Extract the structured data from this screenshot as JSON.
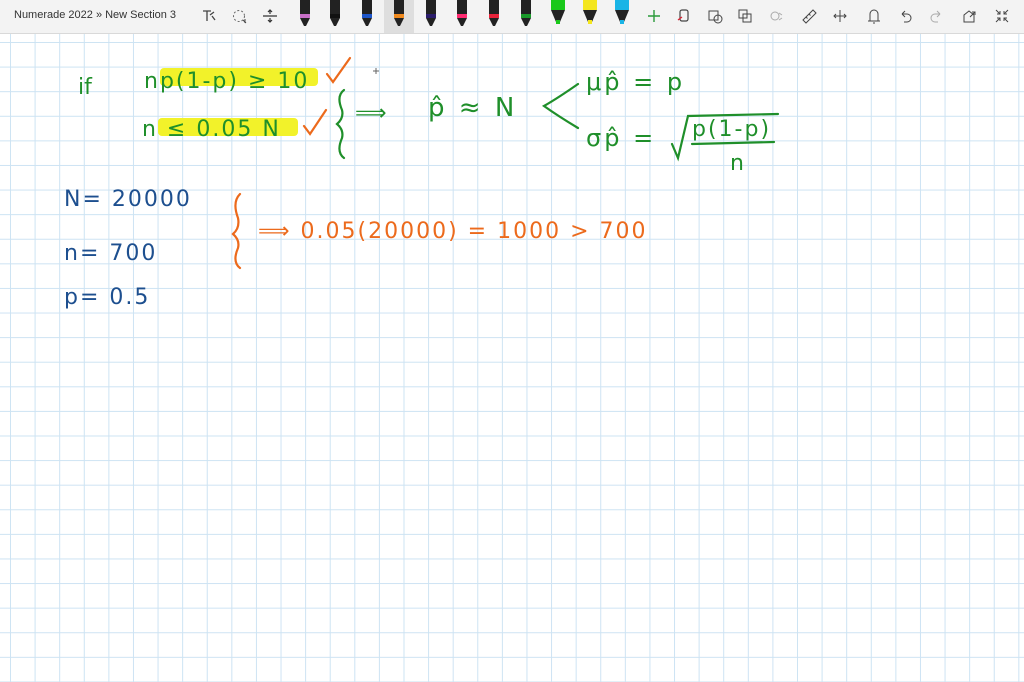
{
  "toolbar": {
    "breadcrumb": "Numerade 2022 » New Section 3",
    "icons": [
      "lasso-select-icon",
      "eraser-icon",
      "add-space-icon",
      "pen-icons",
      "add-pen-icon",
      "ink-to-shape-icon",
      "ink-to-text-icon",
      "ink-to-math-icon",
      "replay-icon",
      "ruler-icon",
      "fit-width-icon",
      "touch-draw-icon",
      "undo-icon",
      "redo-icon",
      "full-page-icon",
      "collapse-icon"
    ],
    "pen_colors": [
      "#c86fc7",
      "#111111",
      "#1e56c9",
      "#f08a1e",
      "#2b1d6b",
      "#ff2b71",
      "#e8233a",
      "#1a9a2a",
      "#19c81a",
      "#f4e61e",
      "#19b4e6"
    ]
  },
  "notes": {
    "cond_if": "if",
    "cond1": "np(1-p) ≥ 10",
    "cond2": "n ≤ 0.05 N",
    "implies1": "⟹",
    "dist_lhs": "p̂ ≈ N",
    "mu_line": "μp̂ = p",
    "sigma_line_lhs": "σp̂ =",
    "sigma_num": "p(1-p)",
    "sigma_den": "n",
    "given_N": "N= 20000",
    "given_n": "n= 700",
    "given_p": "p= 0.5",
    "calc": "⟹ 0.05(20000) = 1000 > 700"
  },
  "colors": {
    "green_ink": "#1f8f2a",
    "blue_ink": "#1d4f8f",
    "orange_ink": "#ec6a1c",
    "highlight": "#f2f22a"
  }
}
